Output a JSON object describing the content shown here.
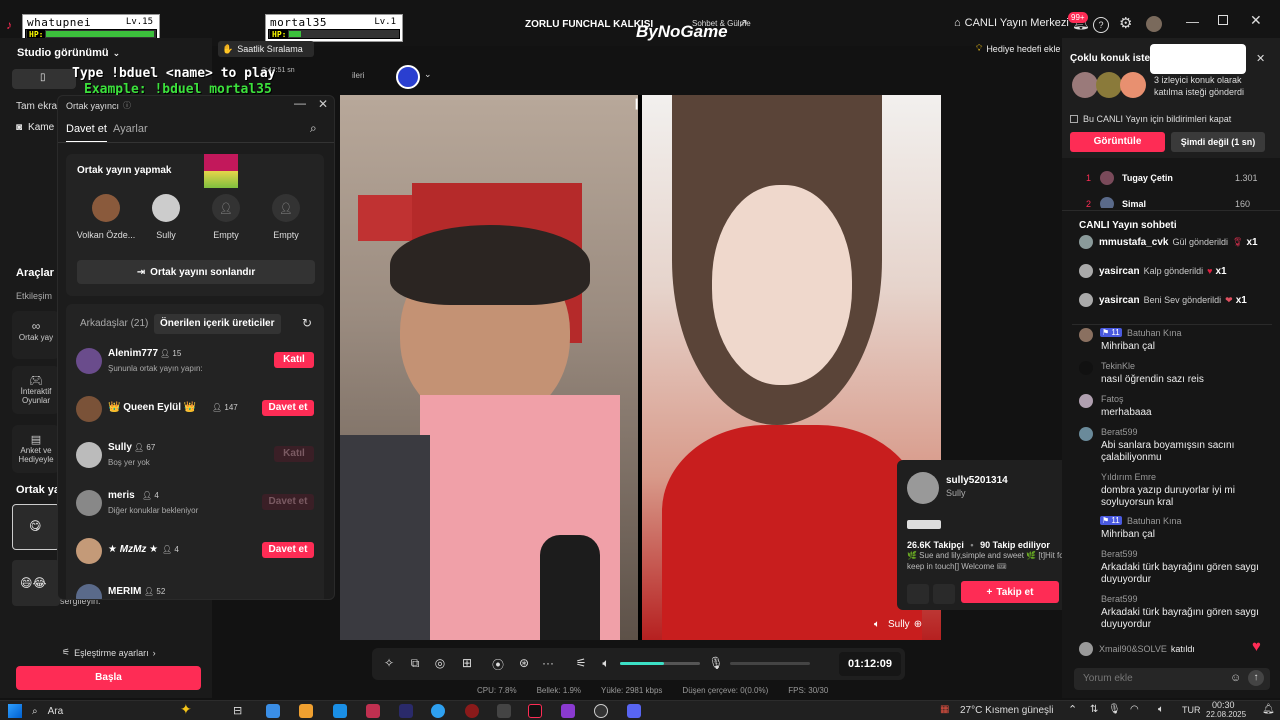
{
  "hud_left": {
    "name": "whatupnei",
    "level": "Lv.15",
    "hp": "HP:"
  },
  "hud_right": {
    "name": "mortal35",
    "level": "Lv.1",
    "hp": "HP:"
  },
  "stream_title": "ZORLU FUNCHAL KALKIŞI",
  "byno": {
    "brand": "ByNoGame",
    "sub": "Sohbet & Gülme"
  },
  "topbar": {
    "live_center": "CANLI Yayın Merkezi",
    "notif_badge": "99+"
  },
  "overlay": {
    "cmd1": "Type !bduel <name> to play",
    "cmd2": "Example: !bduel mortal35",
    "hourly": "Saatlik Sıralama",
    "time_chip": "2:47:51 sn",
    "sub_chip": "ileri"
  },
  "gift_goal": "Hediye hedefi ekle",
  "leftbar": {
    "studio_view": "Studio görünümü",
    "full_screen": "Tam ekran",
    "camera": "Kame",
    "tools": "Araçlar",
    "interaction": "Etkileşim",
    "tile1": "Ortak yay",
    "tile2": "İnteraktif Oyunlar",
    "tile3": "Anket ve Hediyeyle",
    "cohost_short": "Ortak ya",
    "showcase": "sergileyin.",
    "match_settings": "Eşleştirme ayarları",
    "start": "Başla"
  },
  "cohost": {
    "title": "Ortak yayıncı",
    "tab_invite": "Davet et",
    "tab_settings": "Ayarlar",
    "section": "Ortak yayın yapmak",
    "slots": [
      {
        "label": "Volkan Özde..."
      },
      {
        "label": "Sully"
      },
      {
        "label": "Empty"
      },
      {
        "label": "Empty"
      }
    ],
    "end_btn": "Ortak yayını sonlandır",
    "friends_tab": "Arkadaşlar (21)",
    "suggested_tab": "Önerilen içerik üreticiler",
    "friends": [
      {
        "name": "Alenim777",
        "count": "15",
        "sub": "Şununla ortak yayın yapın:",
        "action": "Katıl",
        "state": "red"
      },
      {
        "name": "👑 Queen Eylül 👑",
        "count": "147",
        "sub": "",
        "action": "Davet et",
        "state": "red"
      },
      {
        "name": "Sully",
        "count": "67",
        "sub": "Boş yer yok",
        "action": "Katıl",
        "state": "dim"
      },
      {
        "name": "meris",
        "count": "4",
        "sub": "Diğer konuklar bekleniyor",
        "action": "Davet et",
        "state": "dim"
      },
      {
        "name": "★ MzMz ★",
        "count": "4",
        "sub": "",
        "action": "Davet et",
        "state": "red"
      },
      {
        "name": "MERIM",
        "count": "52",
        "sub": "",
        "action": "Katıl",
        "state": "dim"
      }
    ]
  },
  "video": {
    "right_name": "Sully"
  },
  "profile": {
    "handle": "sully5201314",
    "name": "Sully",
    "followers": "26.6K Takipçi",
    "following": "90 Takip ediliyor",
    "bio": "🌿 Sue and lily,simple and sweet 🌿 [t]Hit follow to keep in touch[] Welcome 🎟",
    "follow_btn": "Takip et"
  },
  "controls": {
    "timer": "01:12:09",
    "volume_level": 0.55
  },
  "stats": {
    "cpu": "CPU: 7.8%",
    "mem": "Bellek: 1.9%",
    "upload": "Yükle: 2981 kbps",
    "dropped": "Düşen çerçeve: 0(0.0%)",
    "fps": "FPS: 30/30"
  },
  "multi_guest": {
    "title": "Çoklu konuk isteği",
    "text": "3 izleyici konuk olarak katılma isteği gönderdi",
    "checkbox": "Bu CANLI Yayın için bildirimleri kapat",
    "view_btn": "Görüntüle",
    "later_btn": "Şimdi değil (1 sn)"
  },
  "ranking": [
    {
      "rank": "1",
      "name": "Tugay Çetin",
      "score": "1.301"
    },
    {
      "rank": "2",
      "name": "Simal",
      "score": "160"
    }
  ],
  "chat": {
    "title": "CANLI Yayın sohbeti",
    "gifts": [
      {
        "user": "mmustafa_cvk",
        "text": "Gül gönderildi",
        "mult": "x1"
      },
      {
        "user": "yasircan",
        "text": "Kalp gönderildi",
        "mult": "x1"
      },
      {
        "user": "yasircan",
        "text": "Beni Sev gönderildi",
        "mult": "x1"
      }
    ],
    "messages": [
      {
        "level": "11",
        "user": "Batuhan Kına",
        "text": "Mihriban çal"
      },
      {
        "level": "",
        "user": "TekinKle",
        "text": "nasıl öğrendin sazı reis"
      },
      {
        "level": "",
        "user": "Fatoş",
        "text": "merhabaaa"
      },
      {
        "level": "",
        "user": "Berat599",
        "text": "Abi sanlara boyamışsın sacını çalabiliyonmu"
      },
      {
        "level": "",
        "user": "Yıldırım Emre",
        "text": "dombra yazıp duruyorlar iyi mi soyluyorsun kral"
      },
      {
        "level": "11",
        "user": "Batuhan Kına",
        "text": "Mihriban çal"
      },
      {
        "level": "",
        "user": "Berat599",
        "text": "Arkadaki türk bayrağını gören saygı duyuyordur"
      },
      {
        "level": "",
        "user": "Berat599",
        "text": "Arkadaki türk bayrağını gören saygı duyuyordur"
      }
    ],
    "joined_user": "Xmail90&SOLVE",
    "joined_text": "katıldı",
    "comment_placeholder": "Yorum ekle"
  },
  "taskbar": {
    "search": "Ara",
    "weather": "27°C  Kısmen güneşli",
    "lang": "TUR",
    "time": "00:30",
    "date": "22.08.2025"
  }
}
